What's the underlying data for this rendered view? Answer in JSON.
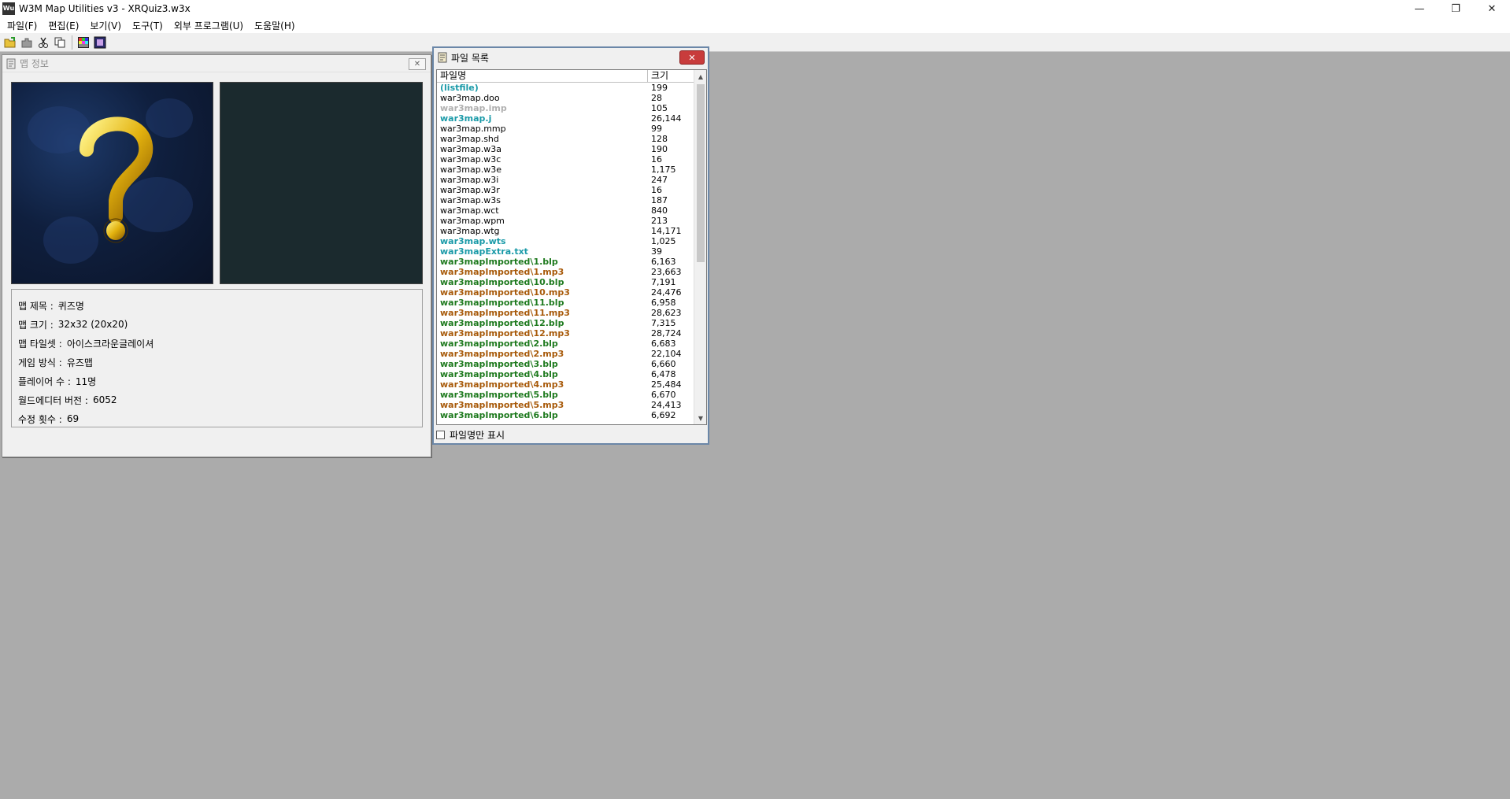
{
  "window": {
    "title": "W3M Map Utilities v3 - XRQuiz3.w3x",
    "app_icon_text": "Wu",
    "minimize": "—",
    "restore": "❐",
    "close": "✕"
  },
  "menu": [
    {
      "label": "파일(F)"
    },
    {
      "label": "편집(E)"
    },
    {
      "label": "보기(V)"
    },
    {
      "label": "도구(T)"
    },
    {
      "label": "외부 프로그램(U)"
    },
    {
      "label": "도움말(H)"
    }
  ],
  "toolbar": {
    "icons": [
      "open-folder-icon",
      "puzzle-icon",
      "scissors-icon",
      "copy-icon",
      "color-grid-icon",
      "image-frame-icon"
    ]
  },
  "mapinfo": {
    "caption": "맵 정보",
    "close_glyph": "✕",
    "rows": [
      {
        "label": "맵 제목 :",
        "value": "퀴즈명"
      },
      {
        "label": "맵 크기 :",
        "value": "32x32 (20x20)"
      },
      {
        "label": "맵 타일셋 :",
        "value": "아이스크라운글레이셔"
      },
      {
        "label": "게임 방식 :",
        "value": "유즈맵"
      },
      {
        "label": "플레이어 수 :",
        "value": " 11명"
      },
      {
        "label": "월드에디터 버전 :",
        "value": " 6052"
      },
      {
        "label": "수정 횟수 :",
        "value": "69"
      }
    ],
    "preview_glyph": "?"
  },
  "filelist": {
    "caption": "파일 목록",
    "close_glyph": "✕",
    "col_name": "파일명",
    "col_size": "크기",
    "names_only_label": "파일명만 표시",
    "colors": {
      "default": "#000000",
      "teal": "#1a9aa8",
      "gray": "#b0b0b0",
      "green": "#1e7a1e",
      "orange": "#a85a0a"
    },
    "files": [
      {
        "name": "(listfile)",
        "size": "199",
        "color": "teal",
        "bold": true
      },
      {
        "name": "war3map.doo",
        "size": "28",
        "color": "default",
        "bold": false
      },
      {
        "name": "war3map.imp",
        "size": "105",
        "color": "gray",
        "bold": true
      },
      {
        "name": "war3map.j",
        "size": "26,144",
        "color": "teal",
        "bold": true
      },
      {
        "name": "war3map.mmp",
        "size": "99",
        "color": "default",
        "bold": false
      },
      {
        "name": "war3map.shd",
        "size": "128",
        "color": "default",
        "bold": false
      },
      {
        "name": "war3map.w3a",
        "size": "190",
        "color": "default",
        "bold": false
      },
      {
        "name": "war3map.w3c",
        "size": "16",
        "color": "default",
        "bold": false
      },
      {
        "name": "war3map.w3e",
        "size": "1,175",
        "color": "default",
        "bold": false
      },
      {
        "name": "war3map.w3i",
        "size": "247",
        "color": "default",
        "bold": false
      },
      {
        "name": "war3map.w3r",
        "size": "16",
        "color": "default",
        "bold": false
      },
      {
        "name": "war3map.w3s",
        "size": "187",
        "color": "default",
        "bold": false
      },
      {
        "name": "war3map.wct",
        "size": "840",
        "color": "default",
        "bold": false
      },
      {
        "name": "war3map.wpm",
        "size": "213",
        "color": "default",
        "bold": false
      },
      {
        "name": "war3map.wtg",
        "size": "14,171",
        "color": "default",
        "bold": false
      },
      {
        "name": "war3map.wts",
        "size": "1,025",
        "color": "teal",
        "bold": true
      },
      {
        "name": "war3mapExtra.txt",
        "size": "39",
        "color": "teal",
        "bold": true
      },
      {
        "name": "war3mapImported\\1.blp",
        "size": "6,163",
        "color": "green",
        "bold": true
      },
      {
        "name": "war3mapImported\\1.mp3",
        "size": "23,663",
        "color": "orange",
        "bold": true
      },
      {
        "name": "war3mapImported\\10.blp",
        "size": "7,191",
        "color": "green",
        "bold": true
      },
      {
        "name": "war3mapImported\\10.mp3",
        "size": "24,476",
        "color": "orange",
        "bold": true
      },
      {
        "name": "war3mapImported\\11.blp",
        "size": "6,958",
        "color": "green",
        "bold": true
      },
      {
        "name": "war3mapImported\\11.mp3",
        "size": "28,623",
        "color": "orange",
        "bold": true
      },
      {
        "name": "war3mapImported\\12.blp",
        "size": "7,315",
        "color": "green",
        "bold": true
      },
      {
        "name": "war3mapImported\\12.mp3",
        "size": "28,724",
        "color": "orange",
        "bold": true
      },
      {
        "name": "war3mapImported\\2.blp",
        "size": "6,683",
        "color": "green",
        "bold": true
      },
      {
        "name": "war3mapImported\\2.mp3",
        "size": "22,104",
        "color": "orange",
        "bold": true
      },
      {
        "name": "war3mapImported\\3.blp",
        "size": "6,660",
        "color": "green",
        "bold": true
      },
      {
        "name": "war3mapImported\\4.blp",
        "size": "6,478",
        "color": "green",
        "bold": true
      },
      {
        "name": "war3mapImported\\4.mp3",
        "size": "25,484",
        "color": "orange",
        "bold": true
      },
      {
        "name": "war3mapImported\\5.blp",
        "size": "6,670",
        "color": "green",
        "bold": true
      },
      {
        "name": "war3mapImported\\5.mp3",
        "size": "24,413",
        "color": "orange",
        "bold": true
      },
      {
        "name": "war3mapImported\\6.blp",
        "size": "6,692",
        "color": "green",
        "bold": true
      }
    ]
  }
}
